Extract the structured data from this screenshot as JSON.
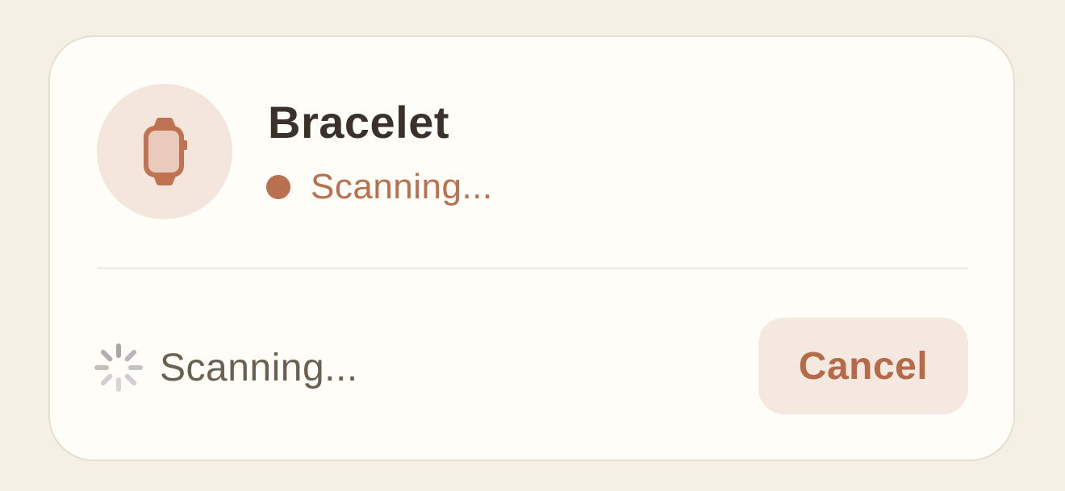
{
  "device": {
    "name": "Bracelet",
    "icon": "watch-icon",
    "status_text": "Scanning..."
  },
  "footer": {
    "status_text": "Scanning...",
    "spinner_icon": "spinner-icon",
    "cancel_label": "Cancel"
  },
  "colors": {
    "accent": "#b8704e",
    "avatar_bg": "#f4e5dd",
    "button_bg": "#f5e8e0",
    "card_bg": "#fefdf8",
    "page_bg": "#f5f0e6"
  }
}
